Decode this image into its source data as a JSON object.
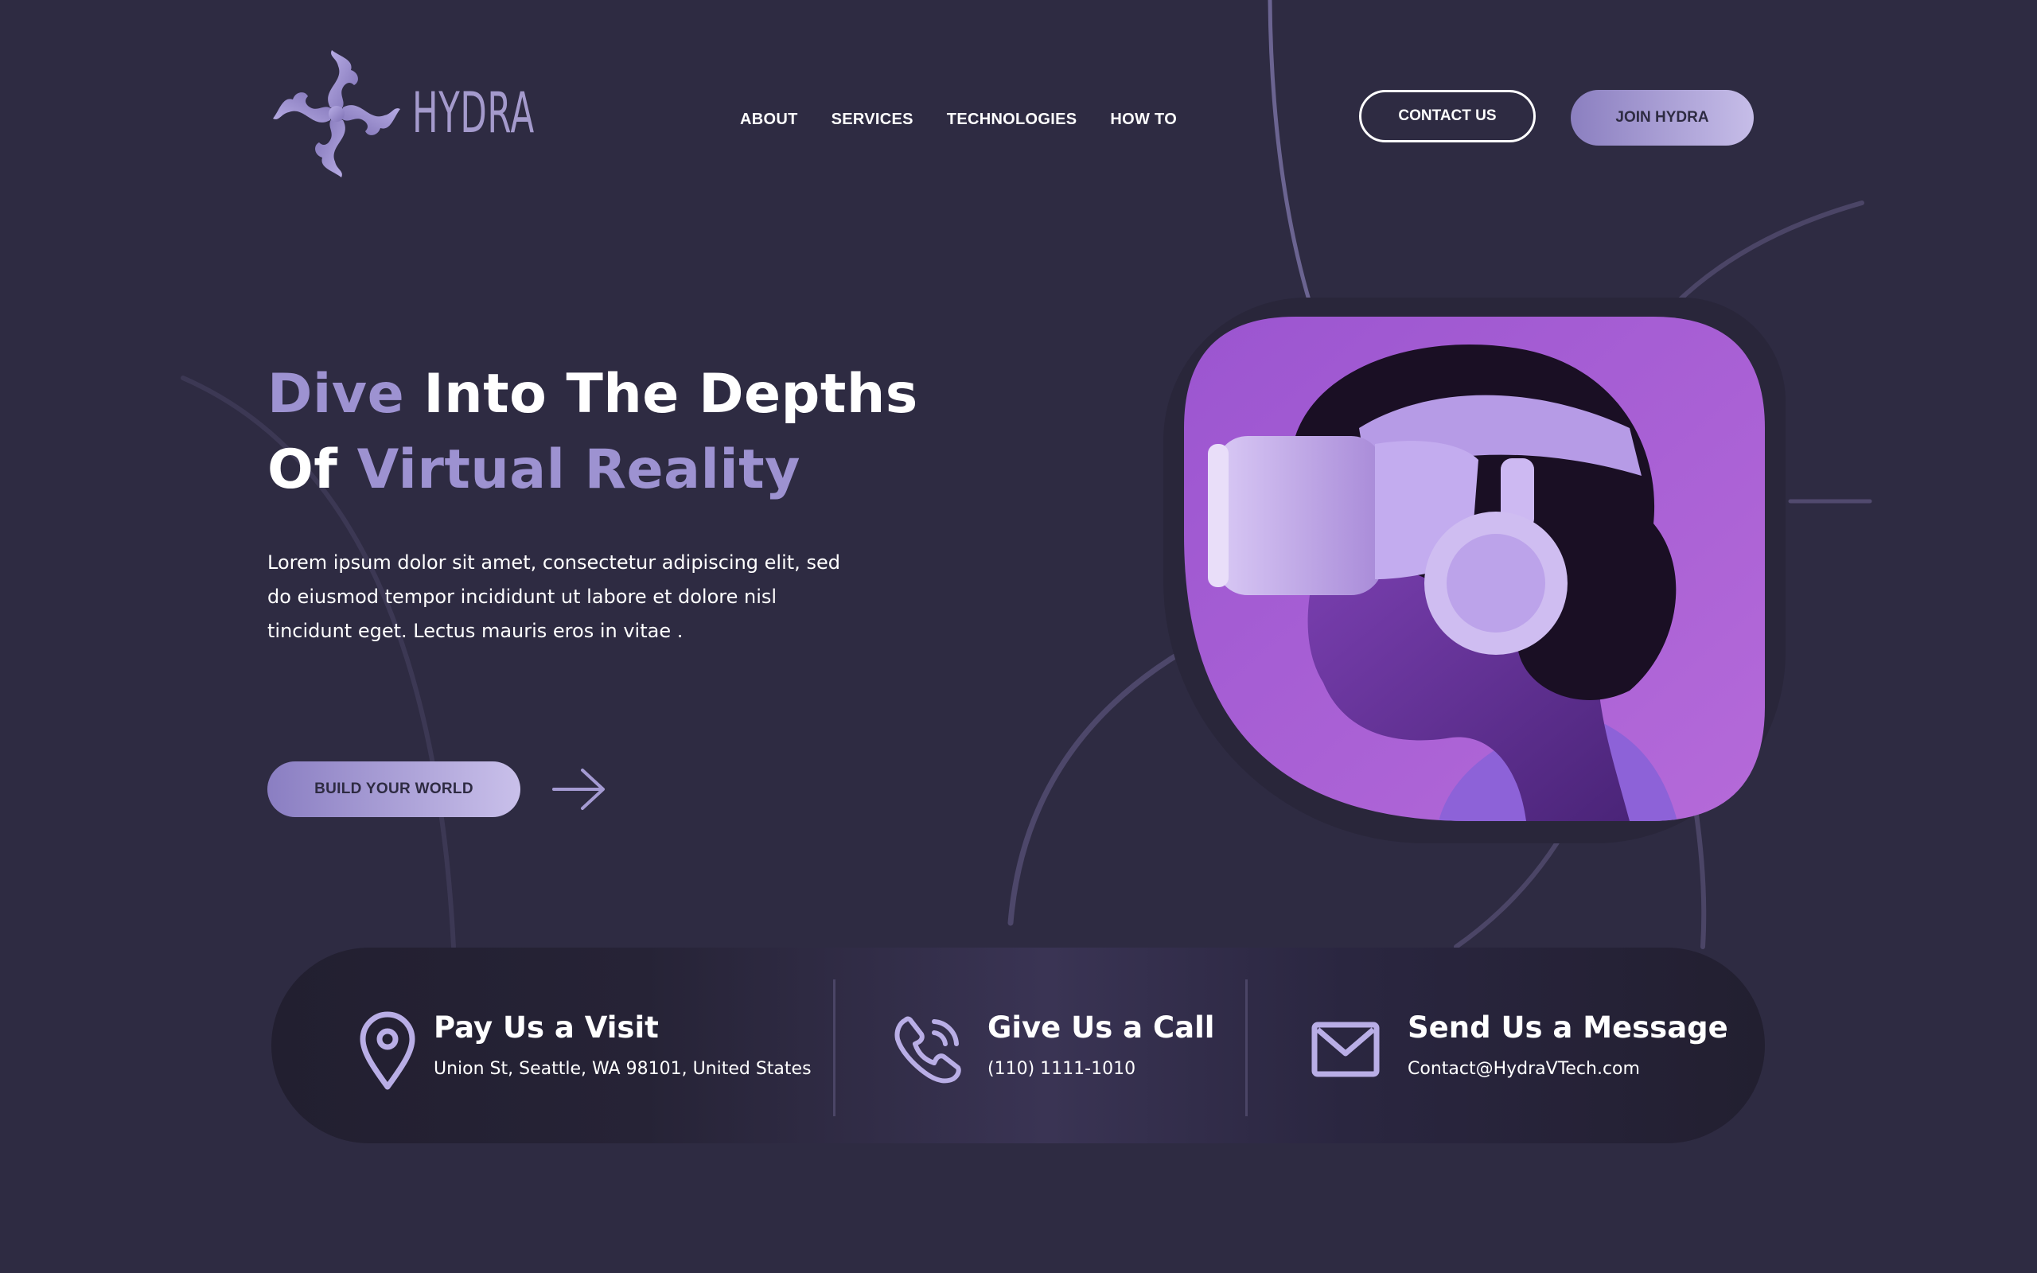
{
  "brand": {
    "name": "HYDRA",
    "accent": "#9d92d1",
    "background": "#2e2b42"
  },
  "nav": {
    "items": [
      "ABOUT",
      "SERVICES",
      "TECHNOLOGIES",
      "HOW TO"
    ]
  },
  "header": {
    "contact_label": "CONTACT US",
    "join_label": "JOIN HYDRA"
  },
  "hero": {
    "title_line1_accent": "Dive",
    "title_line1_rest": " Into The Depths",
    "title_line2_start": "Of ",
    "title_line2_accent": "Virtual Reality",
    "paragraph": "Lorem ipsum dolor sit amet, consectetur adipiscing elit, sed do eiusmod tempor incididunt ut labore et dolore nisl tincidunt eget. Lectus mauris eros in vitae .",
    "cta_label": "BUILD YOUR WORLD",
    "image_subject": "person wearing VR headset and headphones on purple background"
  },
  "contact": {
    "visit": {
      "title": "Pay Us a Visit",
      "detail": "Union St, Seattle, WA 98101, United States",
      "icon": "location-pin-icon"
    },
    "call": {
      "title": "Give Us a Call",
      "detail": "(110) 1111-1010",
      "icon": "phone-icon"
    },
    "message": {
      "title": "Send Us a Message",
      "detail": "Contact@HydraVTech.com",
      "icon": "mail-icon"
    }
  }
}
